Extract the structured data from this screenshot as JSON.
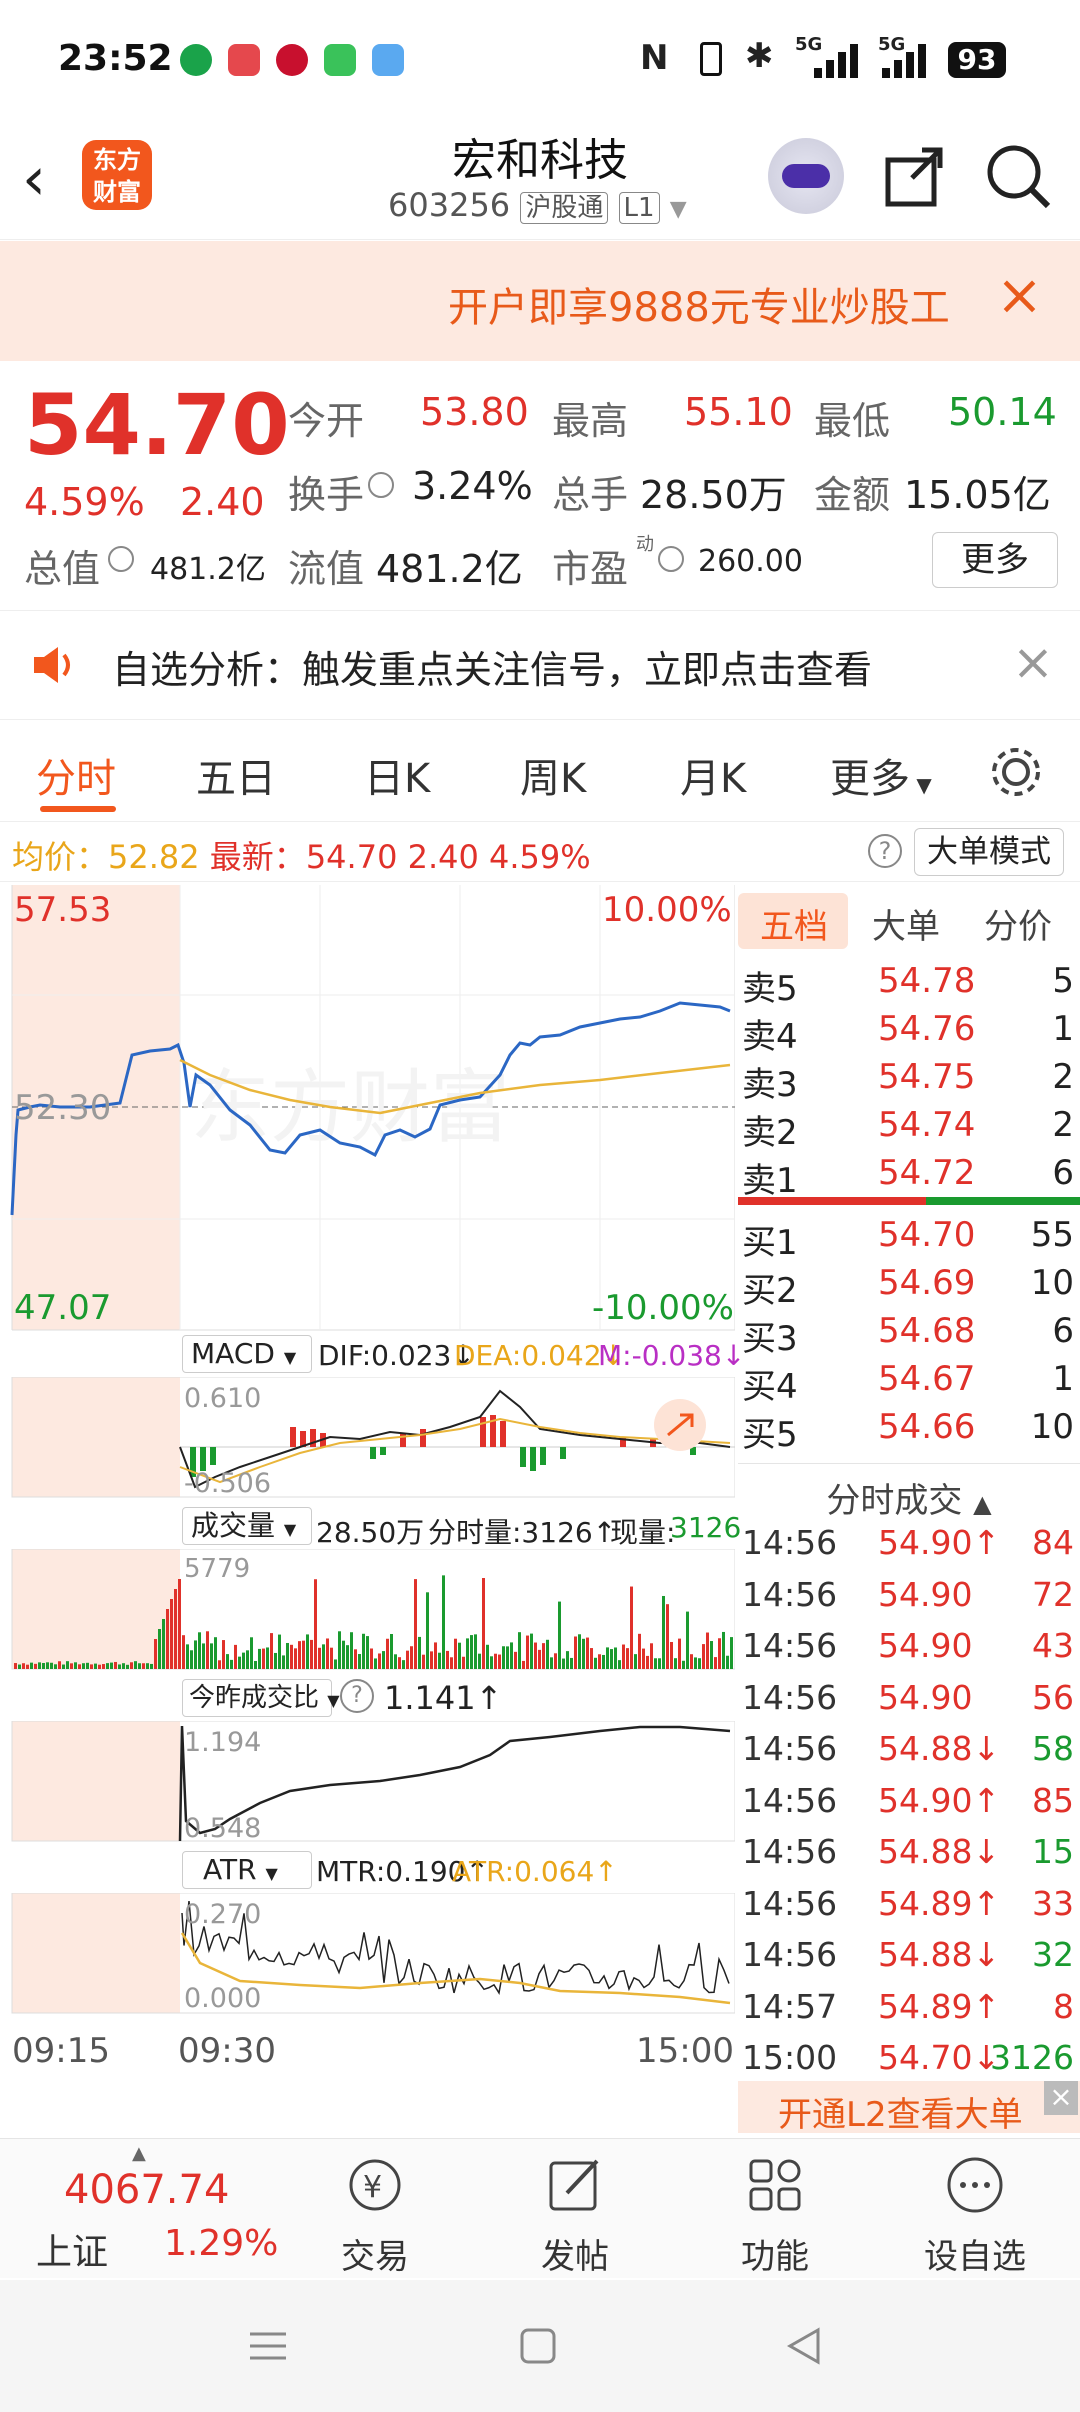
{
  "status_bar": {
    "time": "23:52",
    "nfc": "N",
    "signal1": "5G",
    "signal2": "5G",
    "battery": "93"
  },
  "header": {
    "logo_text": "东方财富",
    "stock_name": "宏和科技",
    "stock_code": "603256",
    "tag_connect": "沪股通",
    "tag_level": "L1"
  },
  "promo": {
    "text": "开户即享9888元专业炒股工"
  },
  "quote": {
    "price": "54.70",
    "change_pct": "4.59%",
    "change": "2.40",
    "open_label": "今开",
    "open": "53.80",
    "high_label": "最高",
    "high": "55.10",
    "low_label": "最低",
    "low": "50.14",
    "turnover_label": "换手",
    "turnover": "3.24%",
    "volume_label": "总手",
    "volume": "28.50万",
    "amount_label": "金额",
    "amount": "15.05亿",
    "mktcap_label": "总值",
    "mktcap": "481.2亿",
    "float_label": "流值",
    "float_cap": "481.2亿",
    "pe_label": "市盈",
    "pe_sup": "动",
    "pe": "260.00",
    "more_button": "更多"
  },
  "notice": {
    "text": "自选分析：触发重点关注信号，立即点击查看"
  },
  "tabs": [
    "分时",
    "五日",
    "日K",
    "周K",
    "月K",
    "更多"
  ],
  "avg_bar": {
    "avg_label": "均价：",
    "avg": "52.82",
    "latest_label": "最新：",
    "latest": "54.70",
    "change": "2.40",
    "pct": "4.59%",
    "mode_button": "大单模式"
  },
  "intraday": {
    "y_top": "57.53",
    "y_mid": "52.30",
    "y_bottom": "47.07",
    "pct_top": "10.00%",
    "pct_bottom": "-10.00%",
    "watermark": "东方财富"
  },
  "macd": {
    "label": "MACD",
    "dif": "DIF:0.023↓",
    "dea": "DEA:0.042↓",
    "m": "M:-0.038↓",
    "top": "0.610",
    "bottom": "-0.506"
  },
  "volume_panel": {
    "label": "成交量",
    "total": "28.50万",
    "minute": "分时量:3126↑",
    "current_label": "现量:",
    "current": "3126",
    "max": "5779"
  },
  "ratio_panel": {
    "label": "今昨成交比",
    "value": "1.141↑",
    "top": "1.194",
    "bottom": "0.548"
  },
  "atr_panel": {
    "label": "ATR",
    "mtr": "MTR:0.190↑",
    "atr": "ATR:0.064↑",
    "top": "0.270",
    "bottom": "0.000"
  },
  "time_axis": [
    "09:15",
    "09:30",
    "15:00"
  ],
  "orderbook": {
    "tabs": [
      "五档",
      "大单",
      "分价"
    ],
    "asks": [
      {
        "label": "卖5",
        "price": "54.78",
        "vol": "5"
      },
      {
        "label": "卖4",
        "price": "54.76",
        "vol": "1"
      },
      {
        "label": "卖3",
        "price": "54.75",
        "vol": "2"
      },
      {
        "label": "卖2",
        "price": "54.74",
        "vol": "2"
      },
      {
        "label": "卖1",
        "price": "54.72",
        "vol": "6"
      }
    ],
    "bids": [
      {
        "label": "买1",
        "price": "54.70",
        "vol": "55"
      },
      {
        "label": "买2",
        "price": "54.69",
        "vol": "10"
      },
      {
        "label": "买3",
        "price": "54.68",
        "vol": "6"
      },
      {
        "label": "买4",
        "price": "54.67",
        "vol": "1"
      },
      {
        "label": "买5",
        "price": "54.66",
        "vol": "10"
      }
    ],
    "ticks_title": "分时成交",
    "ticks": [
      {
        "time": "14:56",
        "price": "54.90↑",
        "vol": "84",
        "vcolor": "#e0312a"
      },
      {
        "time": "14:56",
        "price": "54.90",
        "vol": "72",
        "vcolor": "#e0312a"
      },
      {
        "time": "14:56",
        "price": "54.90",
        "vol": "43",
        "vcolor": "#e0312a"
      },
      {
        "time": "14:56",
        "price": "54.90",
        "vol": "56",
        "vcolor": "#e0312a"
      },
      {
        "time": "14:56",
        "price": "54.88↓",
        "vol": "58",
        "vcolor": "#1a9a2f"
      },
      {
        "time": "14:56",
        "price": "54.90↑",
        "vol": "85",
        "vcolor": "#e0312a"
      },
      {
        "time": "14:56",
        "price": "54.88↓",
        "vol": "15",
        "vcolor": "#1a9a2f"
      },
      {
        "time": "14:56",
        "price": "54.89↑",
        "vol": "33",
        "vcolor": "#e0312a"
      },
      {
        "time": "14:56",
        "price": "54.88↓",
        "vol": "32",
        "vcolor": "#1a9a2f"
      },
      {
        "time": "14:57",
        "price": "54.89↑",
        "vol": "8",
        "vcolor": "#e0312a"
      },
      {
        "time": "15:00",
        "price": "54.70↓",
        "vol": "3126",
        "vcolor": "#1a9a2f"
      }
    ],
    "l2_banner": "开通L2查看大单"
  },
  "bottom_nav": {
    "index_value": "4067.74",
    "index_name": "上证",
    "index_pct": "1.29%",
    "items": [
      "交易",
      "发帖",
      "功能",
      "设自选"
    ]
  },
  "colors": {
    "up": "#e0312a",
    "down": "#1a9a2f",
    "accent": "#f2571d",
    "price_line": "#2b67c4",
    "avg_line": "#e9b53a"
  }
}
